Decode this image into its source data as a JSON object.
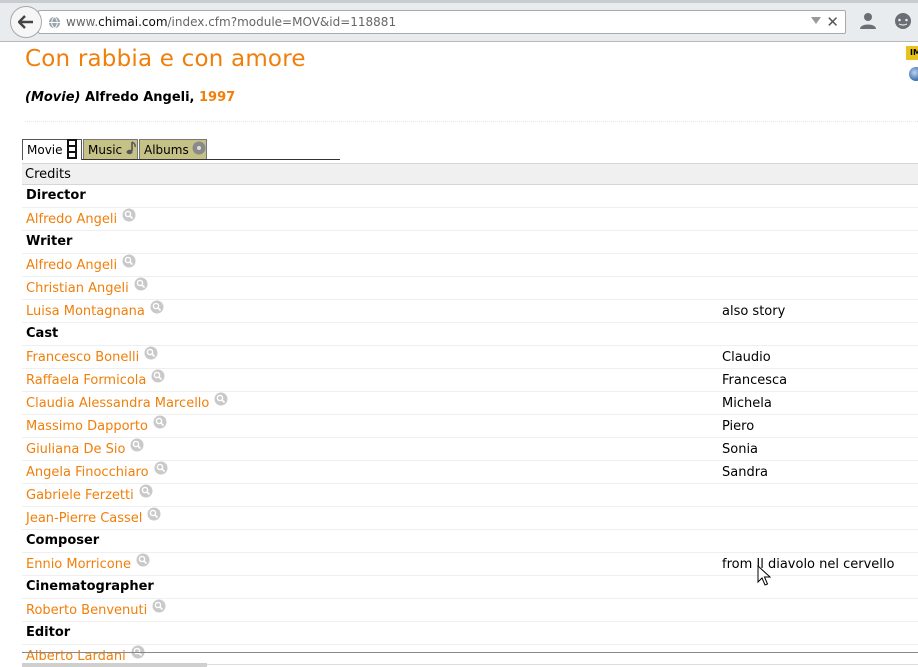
{
  "browser": {
    "url_prefix": "www.",
    "url_domain": "chimai.com",
    "url_path": "/index.cfm?module=MOV&id=118881"
  },
  "movie": {
    "title": "Con rabbia e con amore",
    "type_label": "(Movie)",
    "director_name": "Alfredo Angeli,",
    "year": "1997"
  },
  "badges": {
    "imdb": "IMDb"
  },
  "tabs": [
    {
      "label": "Movie",
      "icon": "film-icon",
      "active": true
    },
    {
      "label": "Music",
      "icon": "music-note-icon",
      "active": false
    },
    {
      "label": "Albums",
      "icon": "disc-icon",
      "active": false
    }
  ],
  "credits": {
    "header": "Credits",
    "rows": [
      {
        "kind": "role",
        "text": "Director"
      },
      {
        "kind": "person",
        "text": "Alfredo Angeli",
        "note": ""
      },
      {
        "kind": "role",
        "text": "Writer"
      },
      {
        "kind": "person",
        "text": "Alfredo Angeli",
        "note": ""
      },
      {
        "kind": "person",
        "text": "Christian Angeli",
        "note": ""
      },
      {
        "kind": "person",
        "text": "Luisa Montagnana",
        "note": "also story"
      },
      {
        "kind": "role",
        "text": "Cast"
      },
      {
        "kind": "person",
        "text": "Francesco Bonelli",
        "note": "Claudio"
      },
      {
        "kind": "person",
        "text": "Raffaela Formicola",
        "note": "Francesca"
      },
      {
        "kind": "person",
        "text": "Claudia Alessandra Marcello",
        "note": "Michela"
      },
      {
        "kind": "person",
        "text": "Massimo Dapporto",
        "note": "Piero"
      },
      {
        "kind": "person",
        "text": "Giuliana De Sio",
        "note": "Sonia"
      },
      {
        "kind": "person",
        "text": "Angela Finocchiaro",
        "note": "Sandra"
      },
      {
        "kind": "person",
        "text": "Gabriele Ferzetti",
        "note": ""
      },
      {
        "kind": "person",
        "text": "Jean-Pierre Cassel",
        "note": ""
      },
      {
        "kind": "role",
        "text": "Composer"
      },
      {
        "kind": "person",
        "text": "Ennio Morricone",
        "note": "from Il diavolo nel cervello"
      },
      {
        "kind": "role",
        "text": "Cinematographer"
      },
      {
        "kind": "person",
        "text": "Roberto Benvenuti",
        "note": ""
      },
      {
        "kind": "role",
        "text": "Editor"
      },
      {
        "kind": "person",
        "text": "Alberto Lardani",
        "note": ""
      }
    ]
  },
  "colors": {
    "accent": "#f07f0a",
    "tab_inactive": "#c6c186",
    "header_bg": "#f0f0f0"
  }
}
